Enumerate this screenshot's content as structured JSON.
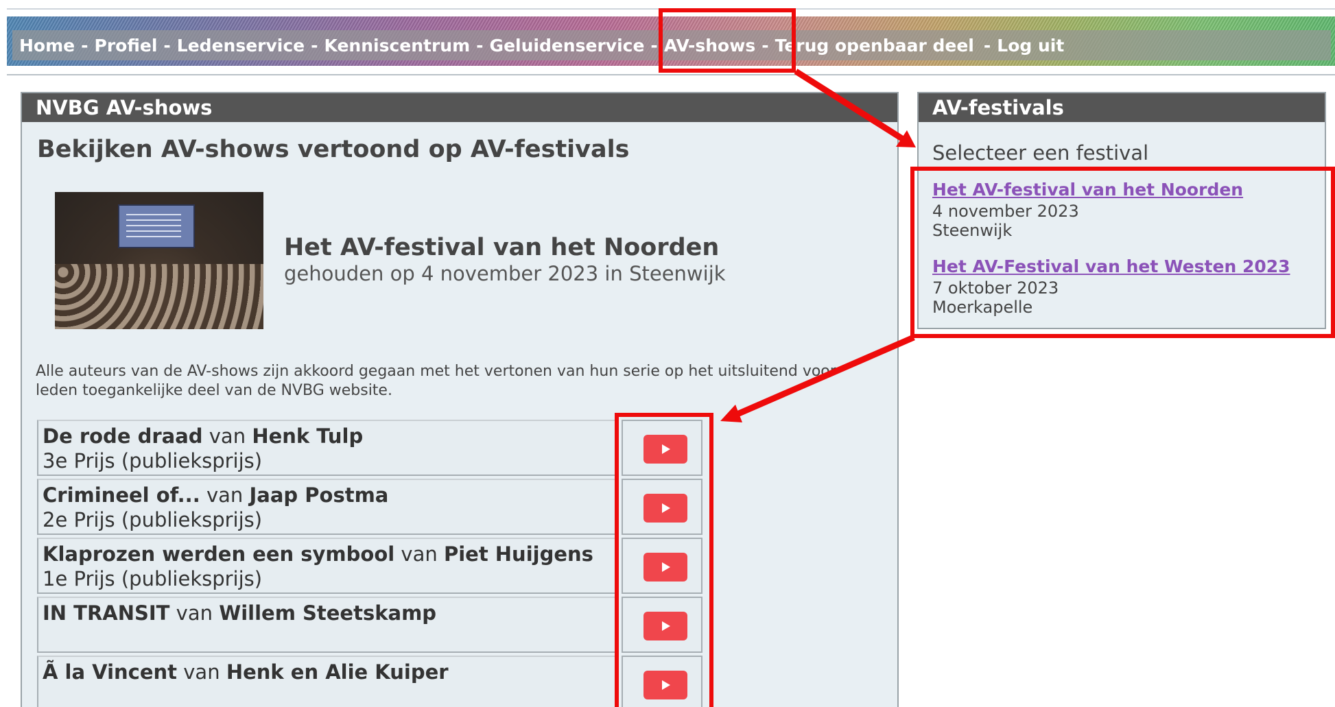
{
  "nav": {
    "items": [
      {
        "label": "Home"
      },
      {
        "label": "Profiel"
      },
      {
        "label": "Ledenservice"
      },
      {
        "label": "Kenniscentrum"
      },
      {
        "label": "Geluidenservice"
      },
      {
        "label": "AV-shows"
      },
      {
        "label": "Terug openbaar deel"
      },
      {
        "label": "Log uit"
      }
    ],
    "separator": "-"
  },
  "main": {
    "panel_title": "NVBG AV-shows",
    "heading": "Bekijken AV-shows vertoond op AV-festivals",
    "festival_title": "Het AV-festival van het Noorden",
    "festival_subtitle": "gehouden op 4 november 2023 in Steenwijk",
    "notice": "Alle auteurs van de AV-shows zijn akkoord gegaan met het vertonen van hun serie op het uitsluitend voor leden toegankelijke deel van de NVBG website.",
    "shows": [
      {
        "title": "De rode draad",
        "by": "van",
        "author": "Henk Tulp",
        "prize": "3e Prijs (publieksprijs)"
      },
      {
        "title": "Crimineel of...",
        "by": "van",
        "author": "Jaap Postma",
        "prize": "2e Prijs (publieksprijs)"
      },
      {
        "title": "Klaprozen werden een symbool",
        "by": "van",
        "author": "Piet Huijgens",
        "prize": "1e Prijs (publieksprijs)"
      },
      {
        "title": "IN TRANSIT",
        "by": "van",
        "author": "Willem Steetskamp",
        "prize": ""
      },
      {
        "title": "Ã  la Vincent",
        "by": "van",
        "author": "Henk en Alie Kuiper",
        "prize": ""
      }
    ]
  },
  "side": {
    "panel_title": "AV-festivals",
    "prompt": "Selecteer een festival",
    "festivals": [
      {
        "name": "Het AV-festival van het Noorden",
        "date": "4 november 2023",
        "place": "Steenwijk"
      },
      {
        "name": "Het AV-Festival van het Westen 2023",
        "date": "7 oktober 2023",
        "place": "Moerkapelle"
      }
    ]
  },
  "colors": {
    "annotation": "#ee0b0b",
    "play_button": "#f0464c",
    "link": "#8b52b8",
    "panel_header": "#555555"
  }
}
